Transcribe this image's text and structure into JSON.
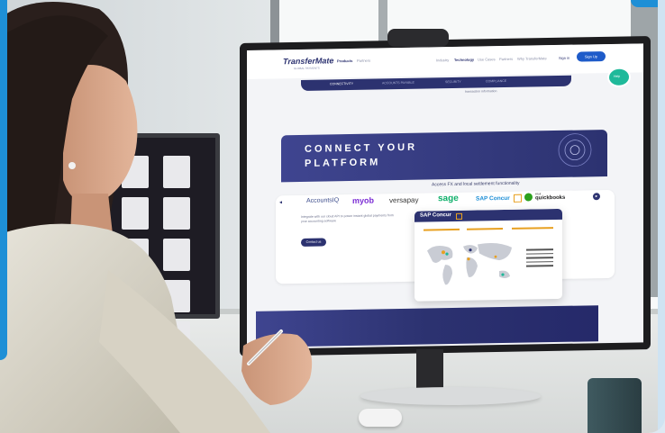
{
  "colors": {
    "accent_blue": "#1e8fd6",
    "navy": "#2c3270",
    "teal_button": "#1fb99a",
    "xero_green": "#10b06b",
    "quickbooks_green": "#2ca01c"
  },
  "site": {
    "logo": "TransferMate",
    "logo_sub": "GLOBAL PAYMENTS",
    "nav_left": [
      "Products",
      "Partners"
    ],
    "nav_right": [
      "Industry",
      "Technology",
      "Use Cases",
      "Partners",
      "Why TransferMate",
      "Sign in",
      "Sign Up"
    ],
    "tabs": [
      "CONNECTIVITY",
      "ACCOUNTS PAYABLE",
      "SECURITY",
      "COMPLIANCE"
    ],
    "info_text": "transaction information",
    "help_button": "Help"
  },
  "hero": {
    "title_line1": "CONNECT YOUR",
    "title_line2": "PLATFORM",
    "subtitle": "Access FX and local settlement functionality"
  },
  "partners": {
    "logos": [
      "AccountsIQ",
      "myob",
      "versapay",
      "sage",
      "SAP Concur",
      "quickbooks"
    ],
    "quickbooks_prefix": "intuit",
    "body_text": "Integrate with our cloud API to power instant global payments from your accounting software",
    "cta": "Contact us"
  },
  "card": {
    "title": "SAP Concur"
  },
  "dock_tiles": 11
}
